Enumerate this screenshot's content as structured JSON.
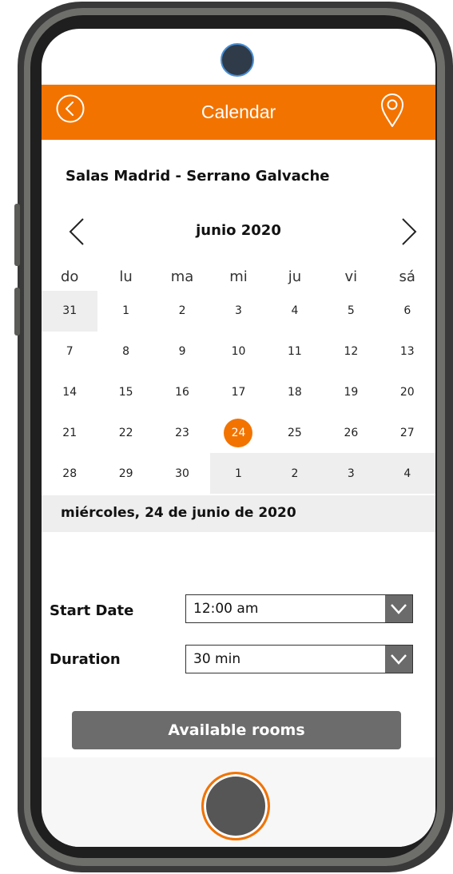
{
  "header": {
    "title": "Calendar",
    "accent_color": "#f27300"
  },
  "venue": {
    "name": "Salas Madrid - Serrano Galvache"
  },
  "calendar": {
    "month_label": "junio 2020",
    "weekdays": [
      "do",
      "lu",
      "ma",
      "mi",
      "ju",
      "vi",
      "sá"
    ],
    "days": [
      {
        "label": "31",
        "other_month": true
      },
      {
        "label": "1"
      },
      {
        "label": "2"
      },
      {
        "label": "3"
      },
      {
        "label": "4"
      },
      {
        "label": "5"
      },
      {
        "label": "6"
      },
      {
        "label": "7"
      },
      {
        "label": "8"
      },
      {
        "label": "9"
      },
      {
        "label": "10"
      },
      {
        "label": "11"
      },
      {
        "label": "12"
      },
      {
        "label": "13"
      },
      {
        "label": "14"
      },
      {
        "label": "15"
      },
      {
        "label": "16"
      },
      {
        "label": "17"
      },
      {
        "label": "18"
      },
      {
        "label": "19"
      },
      {
        "label": "20"
      },
      {
        "label": "21"
      },
      {
        "label": "22"
      },
      {
        "label": "23"
      },
      {
        "label": "24",
        "selected": true
      },
      {
        "label": "25"
      },
      {
        "label": "26"
      },
      {
        "label": "27"
      },
      {
        "label": "28"
      },
      {
        "label": "29"
      },
      {
        "label": "30"
      },
      {
        "label": "1",
        "other_month": true
      },
      {
        "label": "2",
        "other_month": true
      },
      {
        "label": "3",
        "other_month": true
      },
      {
        "label": "4",
        "other_month": true
      }
    ],
    "selected_date_text": "miércoles, 24 de junio de 2020"
  },
  "form": {
    "start_label": "Start Date",
    "start_value": "12:00 am",
    "duration_label": "Duration",
    "duration_value": "30 min",
    "submit_label": "Available rooms"
  },
  "icons": {
    "back": "back-circle-icon",
    "location": "location-pin-icon",
    "prev": "chevron-left-icon",
    "next": "chevron-right-icon",
    "dropdown": "chevron-down-icon"
  }
}
